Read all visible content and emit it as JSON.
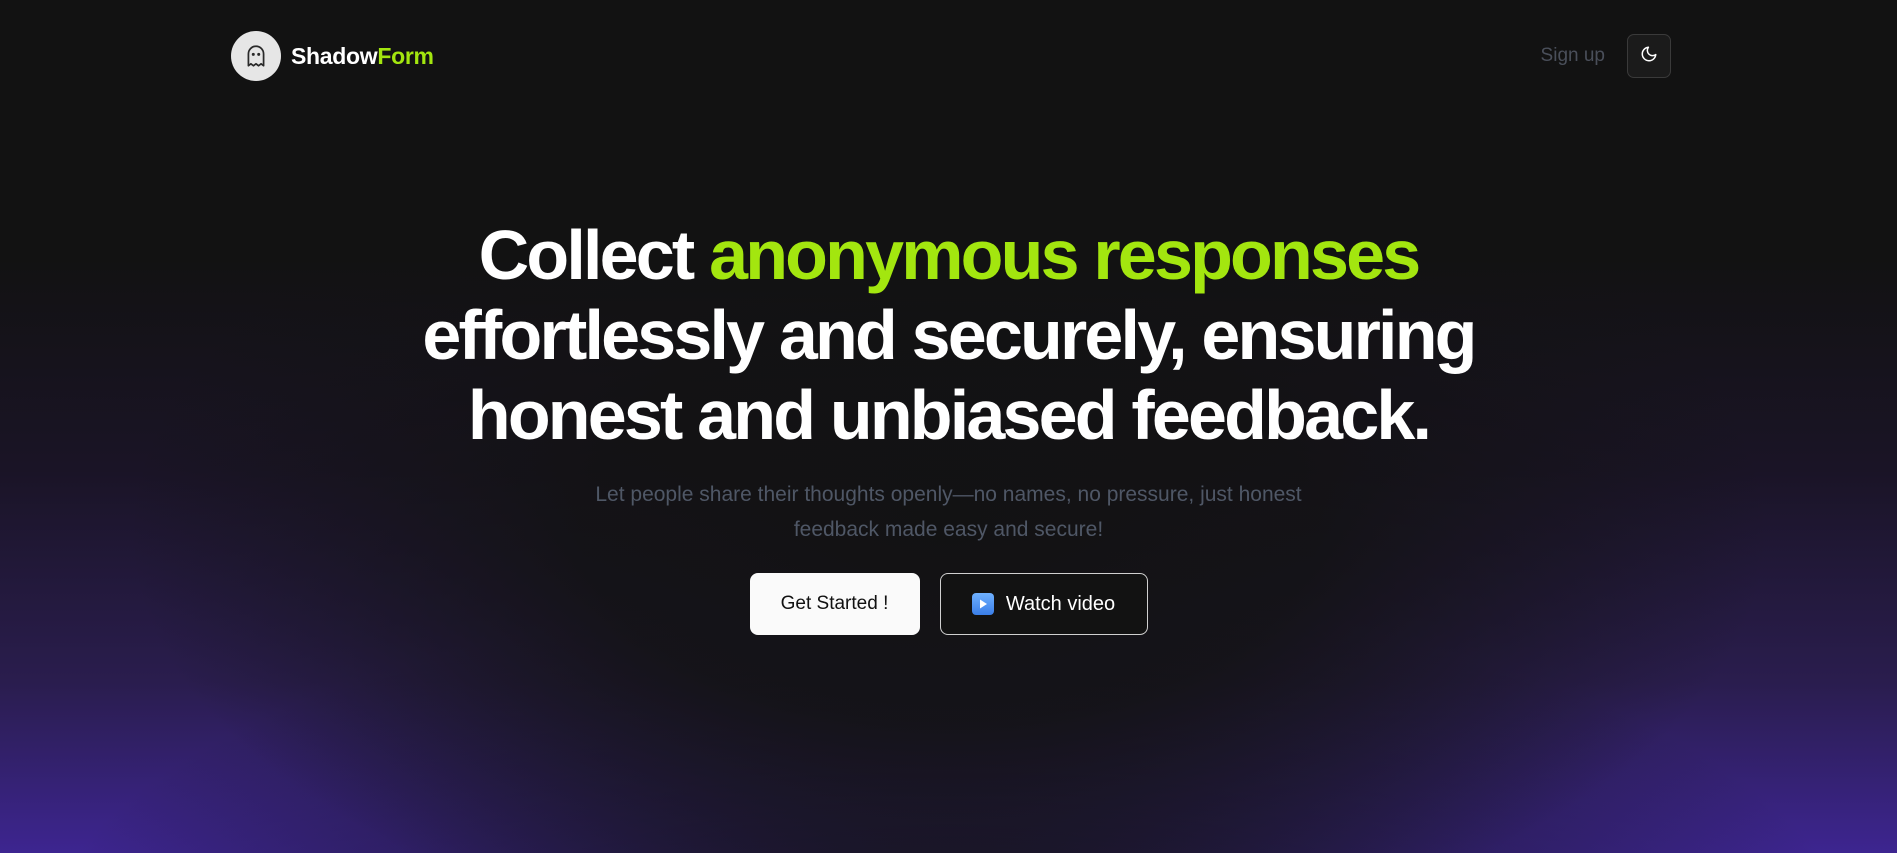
{
  "header": {
    "brand_part1": "Shadow",
    "brand_part2": "Form",
    "logo_icon": "ghost-icon",
    "signup_label": "Sign up",
    "theme_icon": "moon-icon"
  },
  "hero": {
    "headline_part1": "Collect ",
    "headline_highlight": "anonymous responses",
    "headline_part2": " effortlessly and securely, ensuring honest and unbiased feedback.",
    "subtitle": "Let people share their thoughts openly—no names, no pressure, just honest feedback made easy and secure!",
    "primary_cta": "Get Started !",
    "secondary_cta": "Watch video",
    "secondary_cta_icon": "play-button-icon"
  },
  "colors": {
    "accent": "#a3e60f",
    "background": "#121212",
    "gradient_bottom": "#3d2590"
  }
}
